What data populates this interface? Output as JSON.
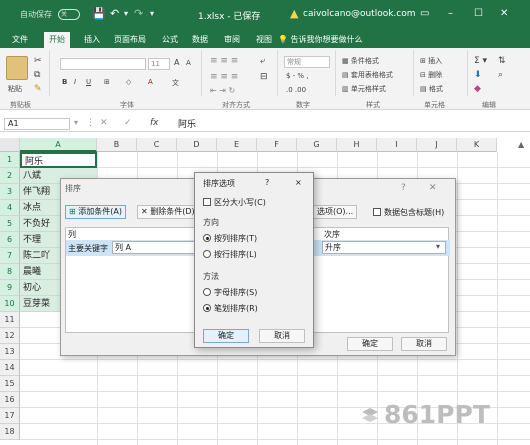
{
  "titlebar": {
    "autosave": "自动保存",
    "toggle": "关",
    "filename": "1.xlsx - 已保存",
    "user": "caivolcano@outlook.com"
  },
  "tabs": [
    "文件",
    "开始",
    "插入",
    "页面布局",
    "公式",
    "数据",
    "审阅",
    "视图"
  ],
  "tell_me": "告诉我你想要做什么",
  "ribbon": {
    "paste": "粘贴",
    "clipboard": "剪贴板",
    "font": "字体",
    "font_size": "11",
    "align": "对齐方式",
    "number_format": "常规",
    "number": "数字",
    "conditional": "条件格式",
    "table_format": "套用表格格式",
    "cell_style": "单元格样式",
    "styles": "样式",
    "insert": "插入",
    "delete": "删除",
    "format": "格式",
    "cells": "单元格",
    "editing": "编辑"
  },
  "formula_bar": {
    "name_box": "A1",
    "fx": "fx",
    "value": "阿乐"
  },
  "columns": [
    "A",
    "B",
    "C",
    "D",
    "E",
    "F",
    "G",
    "H",
    "I",
    "J",
    "K"
  ],
  "rows": [
    "1",
    "2",
    "3",
    "4",
    "5",
    "6",
    "7",
    "8",
    "9",
    "10",
    "11",
    "12",
    "13",
    "14",
    "15",
    "16",
    "17",
    "18"
  ],
  "cells_a": [
    "阿乐",
    "八斌",
    "伴飞翔",
    "冰点",
    "不负好",
    "不理",
    "陈二吖",
    "晨曦",
    "初心",
    "豆芽菜"
  ],
  "sort_dialog": {
    "title": "排序",
    "add": "添加条件(A)",
    "delete": "删除条件(D)",
    "options": "选项(O)...",
    "has_header": "数据包含标题(H)",
    "col_header": "列",
    "order_header": "次序",
    "main_key": "主要关键字",
    "key_value": "列 A",
    "order_value": "升序",
    "ok": "确定",
    "cancel": "取消"
  },
  "options_dialog": {
    "title": "排序选项",
    "help": "?",
    "close": "×",
    "case": "区分大小写(C)",
    "direction": "方向",
    "by_col": "按列排序(T)",
    "by_row": "按行排序(L)",
    "method": "方法",
    "by_letter": "字母排序(S)",
    "by_stroke": "笔划排序(R)",
    "ok": "确定",
    "cancel": "取消"
  },
  "watermark": "861PPT"
}
